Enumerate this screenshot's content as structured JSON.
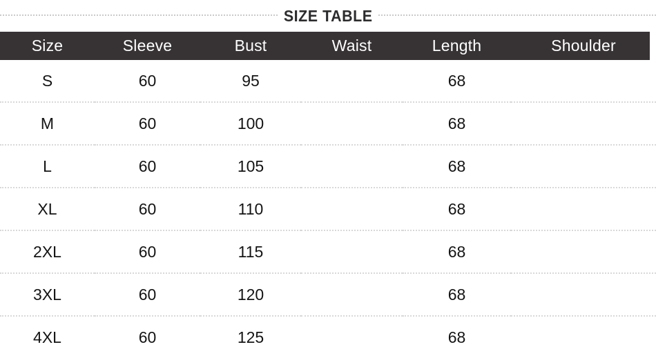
{
  "title": "SIZE TABLE",
  "table": {
    "columns": [
      "Size",
      "Sleeve",
      "Bust",
      "Waist",
      "Length",
      "Shoulder"
    ],
    "rows": [
      {
        "size": "S",
        "sleeve": "60",
        "bust": "95",
        "waist": "",
        "length": "68",
        "shoulder": ""
      },
      {
        "size": "M",
        "sleeve": "60",
        "bust": "100",
        "waist": "",
        "length": "68",
        "shoulder": ""
      },
      {
        "size": "L",
        "sleeve": "60",
        "bust": "105",
        "waist": "",
        "length": "68",
        "shoulder": ""
      },
      {
        "size": "XL",
        "sleeve": "60",
        "bust": "110",
        "waist": "",
        "length": "68",
        "shoulder": ""
      },
      {
        "size": "2XL",
        "sleeve": "60",
        "bust": "115",
        "waist": "",
        "length": "68",
        "shoulder": ""
      },
      {
        "size": "3XL",
        "sleeve": "60",
        "bust": "120",
        "waist": "",
        "length": "68",
        "shoulder": ""
      },
      {
        "size": "4XL",
        "sleeve": "60",
        "bust": "125",
        "waist": "",
        "length": "68",
        "shoulder": ""
      }
    ]
  },
  "colors": {
    "header_background": "#373335",
    "header_text": "#ffffff",
    "body_text": "#141414",
    "title_text": "#2c2c2e",
    "rule": "#c9c9c9",
    "row_separator": "#d8d8d8",
    "page_background": "#ffffff"
  }
}
